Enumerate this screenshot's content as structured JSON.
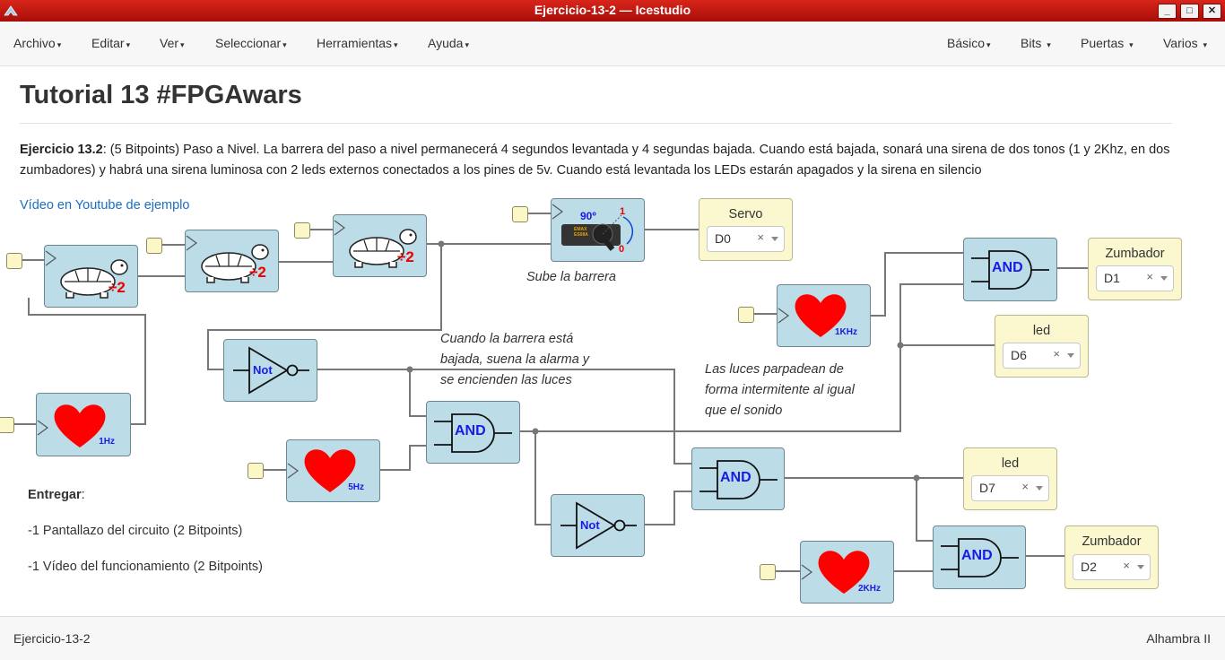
{
  "window": {
    "title": "Ejercicio-13-2 — Icestudio"
  },
  "menu_left": [
    {
      "label": "Archivo"
    },
    {
      "label": "Editar"
    },
    {
      "label": "Ver"
    },
    {
      "label": "Seleccionar"
    },
    {
      "label": "Herramientas"
    },
    {
      "label": "Ayuda"
    }
  ],
  "menu_right": [
    {
      "label": "Básico"
    },
    {
      "label": "Bits"
    },
    {
      "label": "Puertas"
    },
    {
      "label": "Varios"
    }
  ],
  "doc": {
    "heading": "Tutorial 13 #FPGAwars",
    "para_bold": "Ejercicio 13.2",
    "para_rest": ": (5 Bitpoints) Paso a Nivel. La barrera del paso a nivel permanecerá 4 segundos levantada y 4 segundas bajada. Cuando está bajada, sonará una sirena de dos tonos (1 y 2Khz, en dos zumbadores) y habrá una sirena luminosa con 2 leds externos conectados a los pines de 5v. Cuando está levantada los LEDs estarán apagados y la sirena en silencio",
    "link": "Vídeo en Youtube de ejemplo"
  },
  "notes": {
    "servo": "Sube la barrera",
    "alarm": [
      "Cuando la barrera está",
      "bajada, suena la alarma y",
      "se encienden las luces"
    ],
    "leds": [
      "Las luces parpadean de",
      "forma intermitente al igual",
      "que el sonido"
    ]
  },
  "deliver": {
    "title": "Entregar",
    "colon": ":",
    "item1": "-1 Pantallazo del circuito (2 Bitpoints)",
    "item2": "-1 Vídeo del funcionamiento (2 Bitpoints)"
  },
  "blocks": {
    "div_label": "÷2",
    "hb1": "1Hz",
    "hb5": "5Hz",
    "hb1k": "1KHz",
    "hb2k": "2KHz",
    "not": "Not",
    "and": "AND",
    "servo_deg": "90º",
    "servo_one": "1",
    "servo_zero": "0",
    "servo_brand": "EMAX ES08A"
  },
  "outputs": {
    "servo": {
      "label": "Servo",
      "value": "D0"
    },
    "zumb1": {
      "label": "Zumbador",
      "value": "D1"
    },
    "led1": {
      "label": "led",
      "value": "D6"
    },
    "led2": {
      "label": "led",
      "value": "D7"
    },
    "zumb2": {
      "label": "Zumbador",
      "value": "D2"
    },
    "clear": "×"
  },
  "status": {
    "left": "Ejercicio-13-2",
    "right": "Alhambra II"
  },
  "colors": {
    "titlebar": "#c4170f",
    "block": "#bcdde8",
    "port": "#fbf7cf",
    "heart": "#ff0000",
    "gate_text": "#1a1ae6"
  }
}
